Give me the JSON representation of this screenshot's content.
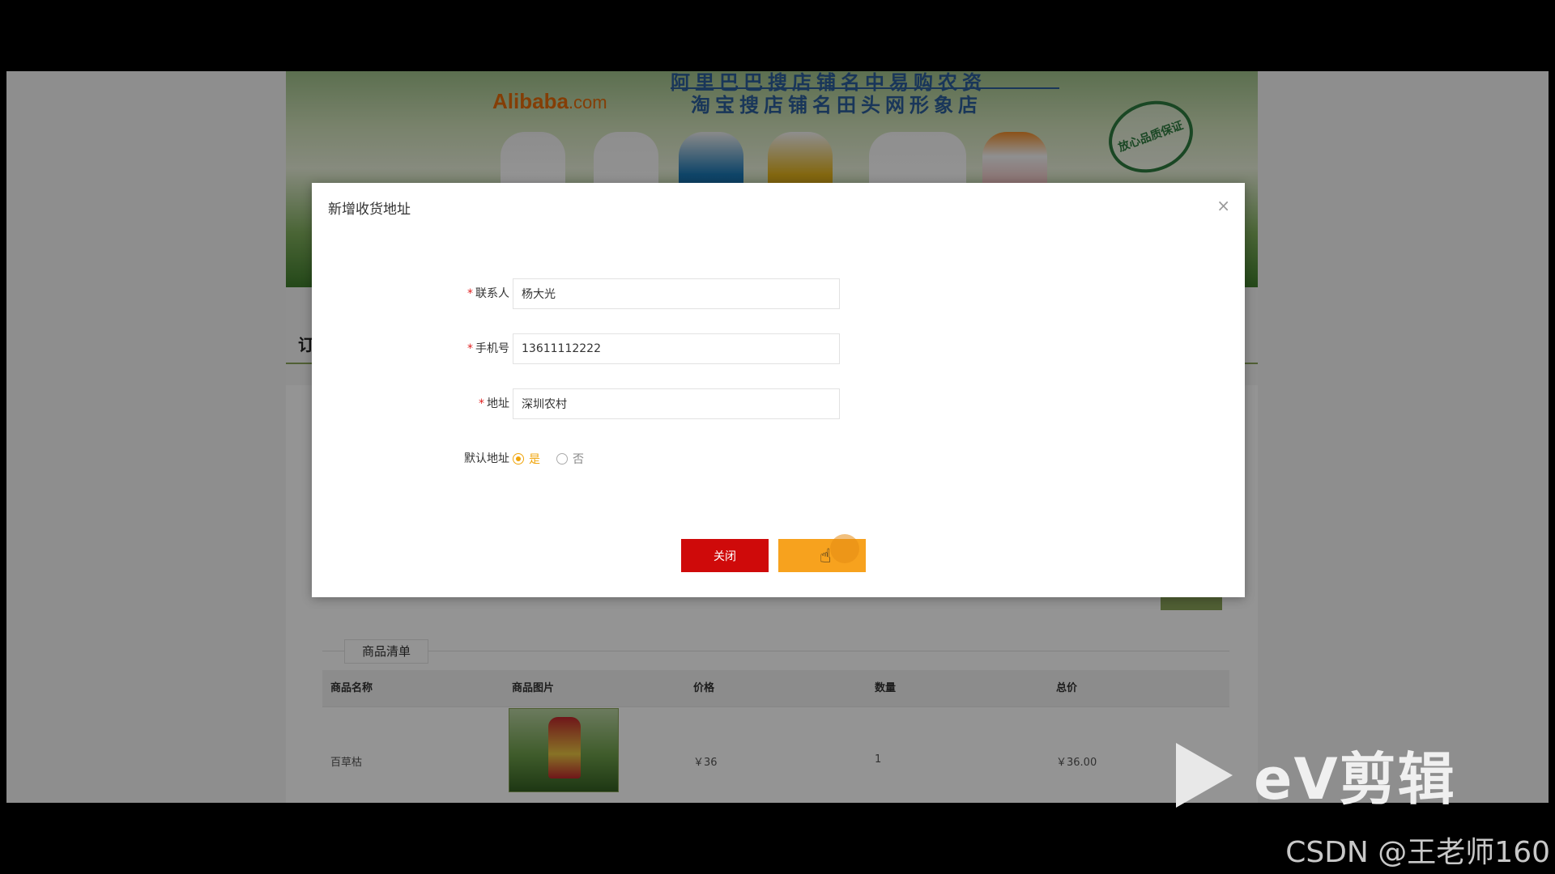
{
  "banner": {
    "logo_text": "Alibaba",
    "logo_suffix": ".com",
    "line1": "阿里巴巴搜店铺名中易购农资",
    "line2": "淘宝搜店铺名田头网形象店",
    "seal_text": "放心品质保证"
  },
  "page": {
    "tab_heading": "订",
    "goods_legend": "商品清单",
    "table": {
      "headers": [
        "商品名称",
        "商品图片",
        "价格",
        "数量",
        "总价"
      ],
      "rows": [
        {
          "name": "百草枯",
          "price": "￥36",
          "quantity": "1",
          "total": "￥36.00"
        }
      ]
    }
  },
  "dialog": {
    "title": "新增收货地址",
    "close_icon": "close-icon",
    "fields": {
      "contact": {
        "label": "联系人",
        "value": "杨大光"
      },
      "phone": {
        "label": "手机号",
        "value": "13611112222"
      },
      "address": {
        "label": "地址",
        "value": "深圳农村"
      }
    },
    "default_address": {
      "label": "默认地址",
      "options": [
        "是",
        "否"
      ],
      "selected": "是"
    },
    "buttons": {
      "close": "关闭",
      "submit": ""
    },
    "accent_color": "#f7a21e",
    "danger_color": "#cf0a0a"
  },
  "watermarks": {
    "ev": "eV剪辑",
    "csdn": "CSDN @王老师160"
  }
}
